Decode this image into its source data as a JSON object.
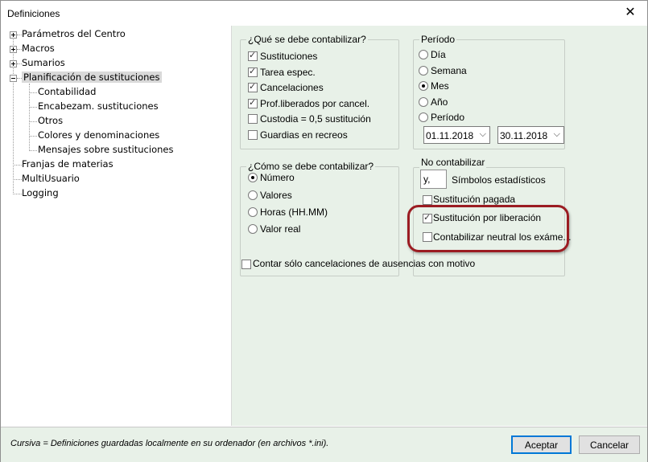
{
  "window": {
    "title": "Definiciones"
  },
  "tree": {
    "items": [
      {
        "label": "Parámetros del Centro"
      },
      {
        "label": "Macros"
      },
      {
        "label": "Sumarios"
      },
      {
        "label": "Planificación de sustituciones"
      },
      {
        "label": "Contabilidad"
      },
      {
        "label": "Encabezam. sustituciones"
      },
      {
        "label": "Otros"
      },
      {
        "label": "Colores y denominaciones"
      },
      {
        "label": "Mensajes sobre sustituciones"
      },
      {
        "label": "Franjas de materias"
      },
      {
        "label": "MultiUsuario"
      },
      {
        "label": "Logging"
      }
    ]
  },
  "que": {
    "title": "¿Qué se debe contabilizar?",
    "items": [
      {
        "label": "Sustituciones",
        "checked": true
      },
      {
        "label": "Tarea espec.",
        "checked": true
      },
      {
        "label": "Cancelaciones",
        "checked": true
      },
      {
        "label": "Prof.liberados por cancel.",
        "checked": true
      },
      {
        "label": "Custodia = 0,5 sustitución",
        "checked": false
      },
      {
        "label": "Guardias en recreos",
        "checked": false
      }
    ]
  },
  "periodo": {
    "title": "Período",
    "items": [
      {
        "label": "Día",
        "checked": false
      },
      {
        "label": "Semana",
        "checked": false
      },
      {
        "label": "Mes",
        "checked": true
      },
      {
        "label": "Año",
        "checked": false
      },
      {
        "label": "Período",
        "checked": false
      }
    ],
    "from": "01.11.2018",
    "to": "30.11.2018"
  },
  "como": {
    "title": "¿Cómo se debe contabilizar?",
    "items": [
      {
        "label": "Número",
        "checked": true
      },
      {
        "label": "Valores",
        "checked": false
      },
      {
        "label": "Horas (HH.MM)",
        "checked": false
      },
      {
        "label": "Valor real",
        "checked": false
      }
    ]
  },
  "no_contabilizar": {
    "title": "No contabilizar",
    "symbol_value": "y,",
    "symbol_label": "Símbolos estadísticos",
    "items": [
      {
        "label": "Sustitución pagada",
        "checked": false
      },
      {
        "label": "Sustitución por liberación",
        "checked": true
      },
      {
        "label": "Contabilizar neutral los exáme...",
        "checked": false
      }
    ]
  },
  "contar": {
    "label": "Contar sólo cancelaciones de ausencias con motivo",
    "checked": false
  },
  "footer": {
    "note": "Cursiva = Definiciones guardadas localmente en su ordenador (en archivos *.ini).",
    "accept": "Aceptar",
    "cancel": "Cancelar"
  },
  "colors": {
    "panel": "#e8f1e8",
    "highlight": "#9b1c22",
    "default_button": "#0078d7"
  },
  "icons": {
    "close": "close-icon",
    "checkbox": "checkbox",
    "radio": "radio",
    "dropdown": "chevron-down-icon",
    "expander": "tree-expander-icon"
  }
}
